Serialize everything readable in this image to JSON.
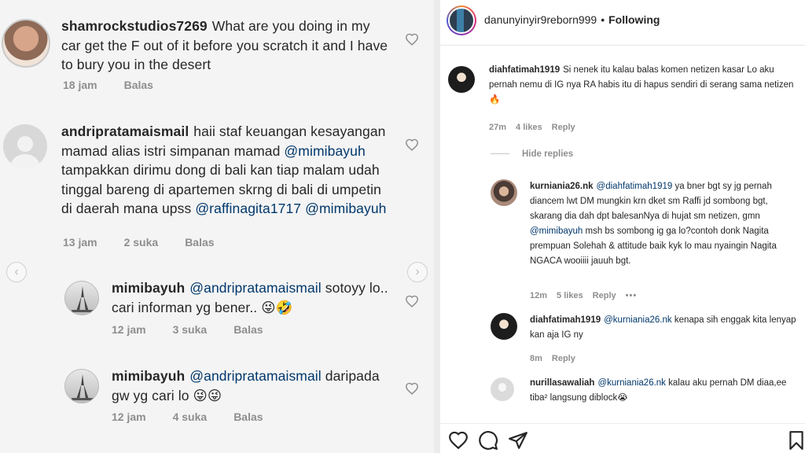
{
  "left": {
    "comments": [
      {
        "username": "shamrockstudios7269",
        "text": "What are you doing in my car get the F out of it before you scratch it and I have to bury you in the desert",
        "time": "18 jam",
        "likes": "",
        "reply_label": "Balas"
      },
      {
        "username": "andripratamaismail",
        "text_a": "haii staf keuangan kesayangan mamad alias istri simpanan mamad",
        "mention_a": "@mimibayuh",
        "text_b": "tampakkan dirimu dong di bali kan tiap malam udah tinggal bareng di apartemen skrng di bali di umpetin di daerah mana upss",
        "mention_b": "@raffinagita1717",
        "mention_c": "@mimibayuh",
        "time": "13 jam",
        "likes": "2 suka",
        "reply_label": "Balas"
      },
      {
        "username": "mimibayuh",
        "mention": "@andripratamaismail",
        "text": "sotoyy lo.. cari informan yg bener.. 😜🤣",
        "time": "12 jam",
        "likes": "3 suka",
        "reply_label": "Balas"
      },
      {
        "username": "mimibayuh",
        "mention": "@andripratamaismail",
        "text": "daripada gw yg cari lo 😜😜",
        "time": "12 jam",
        "likes": "4 suka",
        "reply_label": "Balas"
      }
    ]
  },
  "right": {
    "header": {
      "username": "danunyinyir9reborn999",
      "separator": "•",
      "follow_label": "Following"
    },
    "comments": [
      {
        "username": "diahfatimah1919",
        "text": "Si nenek itu kalau balas komen netizen kasar Lo aku pernah nemu di IG nya RA habis itu di hapus sendiri di serang sama netizen 🔥",
        "time": "27m",
        "likes": "4 likes",
        "reply_label": "Reply"
      },
      {
        "username": "kurniania26.nk",
        "mention_a": "@diahfatimah1919",
        "text_a": "ya bner bgt sy jg pernah diancem lwt DM mungkin krn dket sm Raffi jd sombong bgt, skarang dia dah dpt balesanNya di hujat sm netizen, gmn",
        "mention_b": "@mimibayuh",
        "text_b": "msh bs sombong ig ga lo?contoh donk Nagita prempuan Solehah & attitude baik kyk lo mau nyaingin Nagita NGACA wooiiii jauuh bgt.",
        "time": "12m",
        "likes": "5 likes",
        "reply_label": "Reply",
        "more": "•••"
      },
      {
        "username": "diahfatimah1919",
        "mention": "@kurniania26.nk",
        "text": "kenapa sih enggak kita lenyap kan aja IG ny",
        "time": "8m",
        "likes": "",
        "reply_label": "Reply"
      },
      {
        "username": "nurillasawaliah",
        "mention": "@kurniania26.nk",
        "text": "kalau aku pernah DM diaa,ee tiba² langsung diblock😭",
        "time": "",
        "likes": "",
        "reply_label": ""
      }
    ],
    "hide_replies_label": "Hide replies",
    "actions": [
      "heart-icon",
      "comment-icon",
      "share-icon",
      "save-icon"
    ]
  }
}
